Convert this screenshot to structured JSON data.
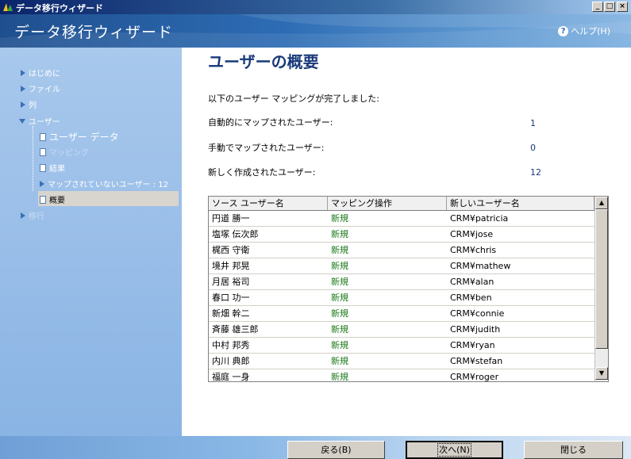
{
  "window": {
    "title": "データ移行ウィザード"
  },
  "header": {
    "title": "データ移行ウィザード",
    "help_label": "ヘルプ(H)"
  },
  "sidebar": {
    "items": [
      {
        "label": "はじめに"
      },
      {
        "label": "ファイル"
      },
      {
        "label": "列"
      },
      {
        "label": "ユーザー"
      },
      {
        "label": "ユーザー データ"
      },
      {
        "label": "マッピング"
      },
      {
        "label": "結果"
      },
      {
        "label": "マップされていないユーザー : 12"
      },
      {
        "label": "概要"
      },
      {
        "label": "移行"
      }
    ]
  },
  "main": {
    "title": "ユーザーの概要",
    "intro": "以下のユーザー マッピングが完了しました:",
    "stats": [
      {
        "label": "自動的にマップされたユーザー:",
        "value": "1"
      },
      {
        "label": "手動でマップされたユーザー:",
        "value": "0"
      },
      {
        "label": "新しく作成されたユーザー:",
        "value": "12"
      }
    ],
    "table": {
      "headers": [
        "ソース ユーザー名",
        "マッピング操作",
        "新しいユーザー名"
      ],
      "rows": [
        [
          "円道 勝一",
          "新規",
          "CRM¥patricia"
        ],
        [
          "塩塚 伝次郎",
          "新規",
          "CRM¥jose"
        ],
        [
          "梶西 守衛",
          "新規",
          "CRM¥chris"
        ],
        [
          "境井 邦晃",
          "新規",
          "CRM¥mathew"
        ],
        [
          "月居 裕司",
          "新規",
          "CRM¥alan"
        ],
        [
          "春口 功一",
          "新規",
          "CRM¥ben"
        ],
        [
          "新畑 幹二",
          "新規",
          "CRM¥connie"
        ],
        [
          "斉藤 雄三郎",
          "新規",
          "CRM¥judith"
        ],
        [
          "中村 邦秀",
          "新規",
          "CRM¥ryan"
        ],
        [
          "内川 典郎",
          "新規",
          "CRM¥stefan"
        ],
        [
          "福庭 一身",
          "新規",
          "CRM¥roger"
        ]
      ]
    }
  },
  "footer": {
    "back_label": "戻る(B)",
    "next_label": "次へ(N)",
    "close_label": "閉じる"
  }
}
